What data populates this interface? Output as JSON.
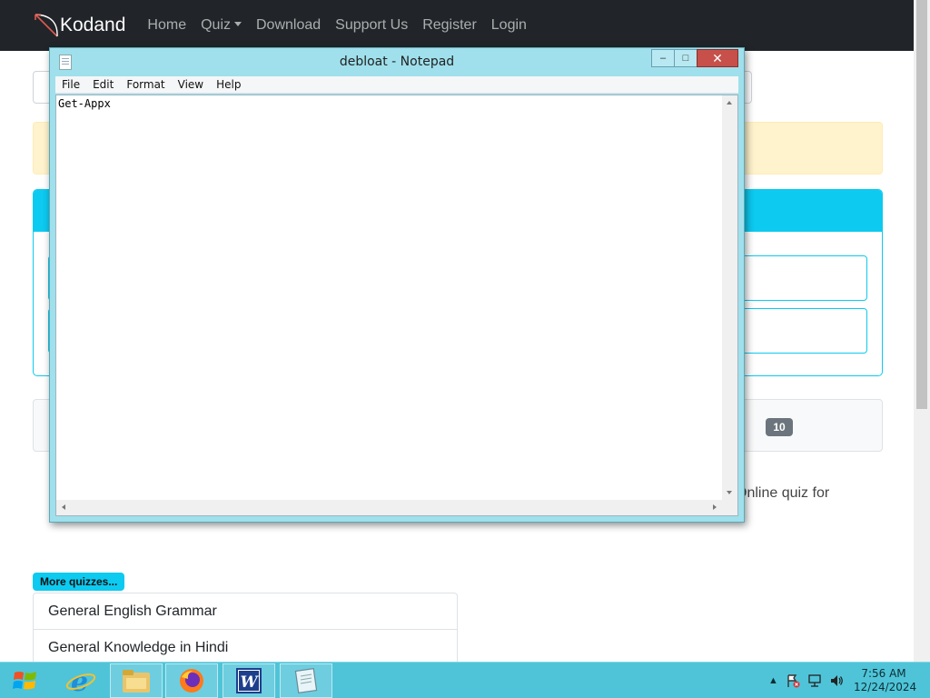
{
  "site": {
    "brand": "Kodand",
    "nav": [
      {
        "label": "Home"
      },
      {
        "label": "Quiz"
      },
      {
        "label": "Download"
      },
      {
        "label": "Support Us"
      },
      {
        "label": "Register"
      },
      {
        "label": "Login"
      }
    ],
    "panel_badge": "10",
    "intro_text": "Online quiz for",
    "more_quizzes_label": "More quizzes...",
    "quizzes": [
      {
        "label": "General English Grammar"
      },
      {
        "label": "General Knowledge in Hindi"
      }
    ]
  },
  "notepad": {
    "title": "debloat - Notepad",
    "menu": [
      "File",
      "Edit",
      "Format",
      "View",
      "Help"
    ],
    "content": "Get-Appx",
    "controls": {
      "minimize": "–",
      "maximize": "□",
      "close": "✕"
    }
  },
  "taskbar": {
    "apps": [
      "internet-explorer",
      "file-explorer",
      "firefox",
      "word",
      "notepad"
    ],
    "clock": {
      "time": "7:56 AM",
      "date": "12/24/2024"
    }
  },
  "colors": {
    "navbar": "#212529",
    "accent": "#0dcaf0",
    "alert": "#fff3cd",
    "window_frame": "#9fe0ec",
    "taskbar": "#4fc4d8",
    "close_button": "#c7504a"
  }
}
